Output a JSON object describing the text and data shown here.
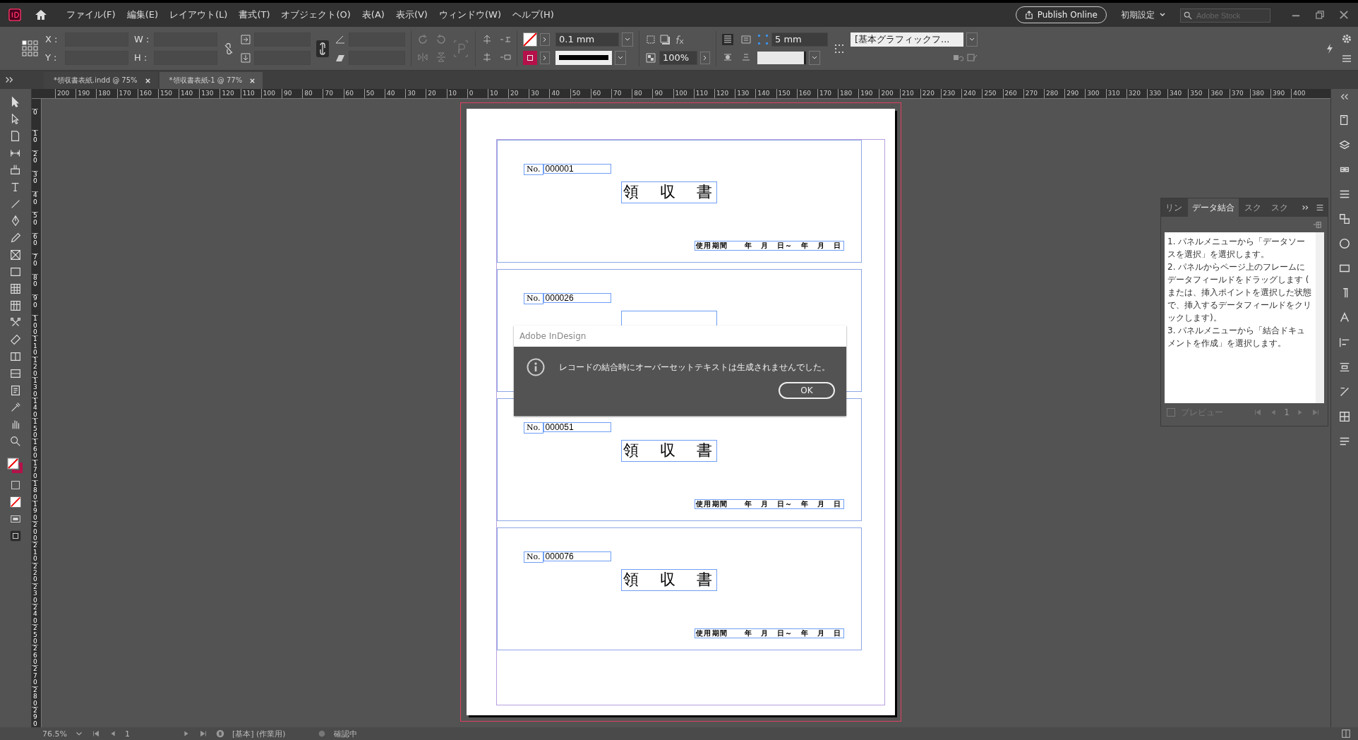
{
  "menubar": {
    "menus": [
      "ファイル(F)",
      "編集(E)",
      "レイアウト(L)",
      "書式(T)",
      "オブジェクト(O)",
      "表(A)",
      "表示(V)",
      "ウィンドウ(W)",
      "ヘルプ(H)"
    ],
    "publish_button": "Publish Online",
    "workspace": "初期設定",
    "stock_search": {
      "placeholder": "Adobe Stock"
    }
  },
  "control_bar": {
    "x_label": "X :",
    "y_label": "Y :",
    "w_label": "W :",
    "h_label": "H :",
    "stroke_weight": "0.1 mm",
    "opacity": "100%",
    "spacing": "5 mm",
    "object_style": "[基本グラフィックフ..."
  },
  "document_tabs": [
    {
      "label": "*領収書表紙.indd @ 75%",
      "selected": false
    },
    {
      "label": "*領収書表紙-1 @ 77%",
      "selected": true
    }
  ],
  "rulers": {
    "horizontal": [
      "200",
      "190",
      "180",
      "170",
      "160",
      "150",
      "140",
      "130",
      "120",
      "110",
      "100",
      "90",
      "80",
      "70",
      "60",
      "50",
      "40",
      "30",
      "20",
      "10",
      "0",
      "10",
      "20",
      "30",
      "40",
      "50",
      "60",
      "70",
      "80",
      "90",
      "100",
      "110",
      "120",
      "130",
      "140",
      "150",
      "160",
      "170",
      "180",
      "190",
      "200",
      "210",
      "220",
      "230",
      "240",
      "250",
      "260",
      "270",
      "280",
      "290",
      "300",
      "310",
      "320",
      "330",
      "340",
      "350",
      "360",
      "370",
      "380",
      "390",
      "400"
    ],
    "vertical": [
      "0",
      "10",
      "20",
      "30",
      "40",
      "50",
      "60",
      "70",
      "80",
      "90",
      "100",
      "110",
      "120",
      "130",
      "140",
      "150",
      "160",
      "170",
      "180",
      "190",
      "200",
      "210",
      "220",
      "230",
      "240",
      "250",
      "260",
      "270",
      "280",
      "290"
    ]
  },
  "receipts": [
    {
      "no_label": "No.",
      "number": "000001",
      "title": "領　収　書",
      "period": "使用期間　　年　月　日～　年　月　日"
    },
    {
      "no_label": "No.",
      "number": "000026"
    },
    {
      "no_label": "No.",
      "number": "000051",
      "title": "領　収　書",
      "period": "使用期間　　年　月　日～　年　月　日"
    },
    {
      "no_label": "No.",
      "number": "000076",
      "title": "領　収　書",
      "period": "使用期間　　年　月　日～　年　月　日"
    }
  ],
  "dialog": {
    "title": "Adobe InDesign",
    "message": "レコードの結合時にオーバーセットテキストは生成されませんでした。",
    "button": "OK"
  },
  "data_merge_panel": {
    "tabs": [
      {
        "label": "リン",
        "selected": false
      },
      {
        "label": "データ結合",
        "selected": true
      },
      {
        "label": "スク",
        "selected": false
      },
      {
        "label": "スク",
        "selected": false
      }
    ],
    "instructions": [
      "1. パネルメニューから「データソースを選択」を選択します。",
      "2. パネルからページ上のフレームにデータフィールドをドラッグします ( または、挿入ポイントを選択した状態で、挿入するデータフィールドをクリックします)。",
      "3. パネルメニューから「結合ドキュメントを作成」を選択します。"
    ],
    "preview": {
      "label": "プレビュー",
      "checked": false
    },
    "record": "1"
  },
  "status_bar": {
    "zoom": "76.5%",
    "page": "1",
    "style": "[基本] (作業用)",
    "preflight": "確認中"
  }
}
